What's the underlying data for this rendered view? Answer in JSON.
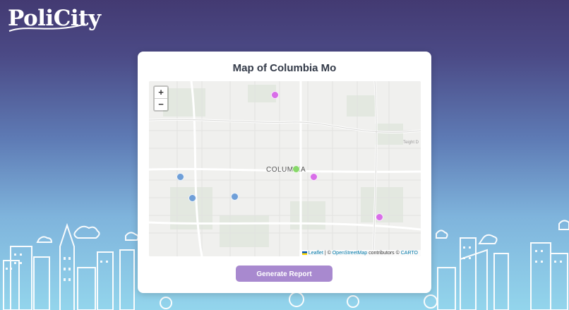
{
  "brand": {
    "logo_text": "PoliCity"
  },
  "card": {
    "title": "Map of Columbia Mo"
  },
  "map": {
    "city_label": "COLUMBIA",
    "zoom_in_label": "+",
    "zoom_out_label": "−",
    "attribution": {
      "leaflet": "Leaflet",
      "separator": "| ©",
      "osm": "OpenStreetMap",
      "contributors": "contributors ©",
      "carto": "CARTO"
    },
    "markers": [
      {
        "id": "m1",
        "color": "#d86ee8"
      },
      {
        "id": "m2",
        "color": "#6f9fd8"
      },
      {
        "id": "m3",
        "color": "#6f9fd8"
      },
      {
        "id": "m4",
        "color": "#6f9fd8"
      },
      {
        "id": "m5",
        "color": "#88d86a"
      },
      {
        "id": "m6",
        "color": "#d86ee8"
      },
      {
        "id": "m7",
        "color": "#d86ee8"
      }
    ],
    "street_label": "Teight D"
  },
  "actions": {
    "generate_report_label": "Generate Report"
  },
  "colors": {
    "accent": "#a889cf",
    "header_bg": "#433a72"
  }
}
